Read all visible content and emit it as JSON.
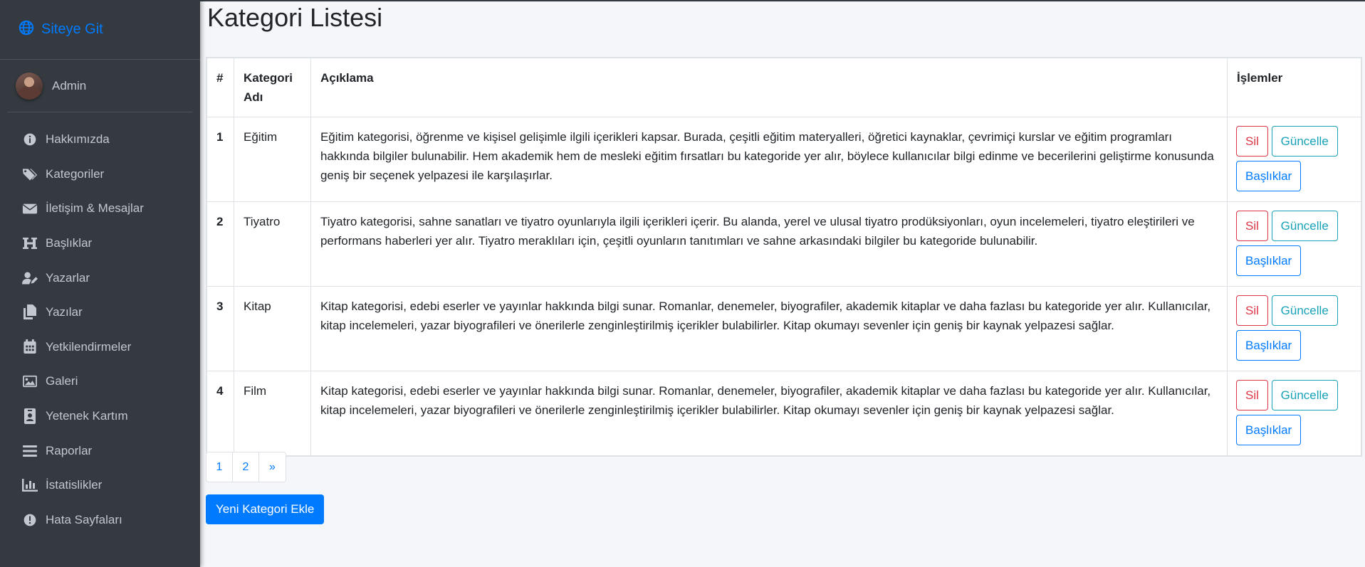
{
  "brand": {
    "label": "Siteye Git"
  },
  "user": {
    "name": "Admin"
  },
  "sidebar": {
    "items": [
      {
        "label": "Hakkımızda",
        "icon": "info-circle-icon"
      },
      {
        "label": "Kategoriler",
        "icon": "tags-icon"
      },
      {
        "label": "İletişim & Mesajlar",
        "icon": "envelope-icon"
      },
      {
        "label": "Başlıklar",
        "icon": "heading-icon"
      },
      {
        "label": "Yazarlar",
        "icon": "user-edit-icon"
      },
      {
        "label": "Yazılar",
        "icon": "copy-icon"
      },
      {
        "label": "Yetkilendirmeler",
        "icon": "calendar-icon"
      },
      {
        "label": "Galeri",
        "icon": "image-icon"
      },
      {
        "label": "Yetenek Kartım",
        "icon": "id-badge-icon"
      },
      {
        "label": "Raporlar",
        "icon": "bars-icon"
      },
      {
        "label": "İstatislikler",
        "icon": "chart-bar-icon"
      },
      {
        "label": "Hata Sayfaları",
        "icon": "exclamation-circle-icon"
      }
    ]
  },
  "page": {
    "title": "Kategori Listesi"
  },
  "table": {
    "headers": {
      "num": "#",
      "name": "Kategori Adı",
      "desc": "Açıklama",
      "actions": "İşlemler"
    },
    "rows": [
      {
        "num": "1",
        "name": "Eğitim",
        "desc": "Eğitim kategorisi, öğrenme ve kişisel gelişimle ilgili içerikleri kapsar. Burada, çeşitli eğitim materyalleri, öğretici kaynaklar, çevrimiçi kurslar ve eğitim programları hakkında bilgiler bulunabilir. Hem akademik hem de mesleki eğitim fırsatları bu kategoride yer alır, böylece kullanıcılar bilgi edinme ve becerilerini geliştirme konusunda geniş bir seçenek yelpazesi ile karşılaşırlar."
      },
      {
        "num": "2",
        "name": "Tiyatro",
        "desc": "Tiyatro kategorisi, sahne sanatları ve tiyatro oyunlarıyla ilgili içerikleri içerir. Bu alanda, yerel ve ulusal tiyatro prodüksiyonları, oyun incelemeleri, tiyatro eleştirileri ve performans haberleri yer alır. Tiyatro meraklıları için, çeşitli oyunların tanıtımları ve sahne arkasındaki bilgiler bu kategoride bulunabilir."
      },
      {
        "num": "3",
        "name": "Kitap",
        "desc": "Kitap kategorisi, edebi eserler ve yayınlar hakkında bilgi sunar. Romanlar, denemeler, biyografiler, akademik kitaplar ve daha fazlası bu kategoride yer alır. Kullanıcılar, kitap incelemeleri, yazar biyografileri ve önerilerle zenginleştirilmiş içerikler bulabilirler. Kitap okumayı sevenler için geniş bir kaynak yelpazesi sağlar."
      },
      {
        "num": "4",
        "name": "Film",
        "desc": "Kitap kategorisi, edebi eserler ve yayınlar hakkında bilgi sunar. Romanlar, denemeler, biyografiler, akademik kitaplar ve daha fazlası bu kategoride yer alır. Kullanıcılar, kitap incelemeleri, yazar biyografileri ve önerilerle zenginleştirilmiş içerikler bulabilirler. Kitap okumayı sevenler için geniş bir kaynak yelpazesi sağlar."
      }
    ],
    "buttons": {
      "delete": "Sil",
      "update": "Güncelle",
      "headings": "Başlıklar"
    }
  },
  "pagination": {
    "pages": [
      "1",
      "2",
      "»"
    ]
  },
  "actions": {
    "add_label": "Yeni Kategori Ekle"
  },
  "colors": {
    "sidebar_bg": "#343a40",
    "accent": "#007bff",
    "danger": "#dc3545",
    "info": "#17a2b8"
  }
}
